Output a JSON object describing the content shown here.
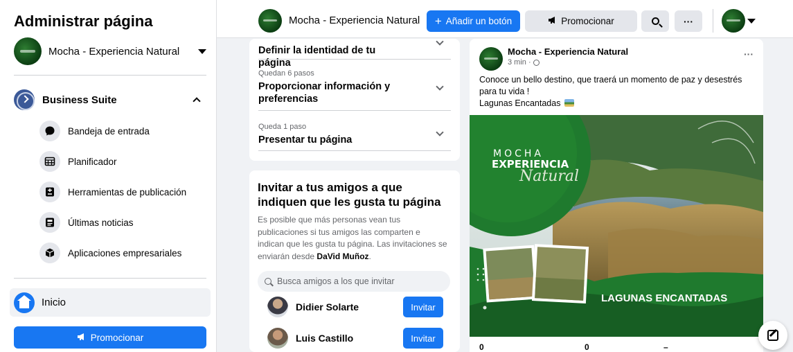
{
  "sidebar": {
    "title": "Administrar página",
    "page_name": "Mocha - Experiencia Natural",
    "business_suite": "Business Suite",
    "items": [
      {
        "label": "Bandeja de entrada",
        "icon": "chat-bubble-icon"
      },
      {
        "label": "Planificador",
        "icon": "calendar-icon"
      },
      {
        "label": "Herramientas de publicación",
        "icon": "publishing-tools-icon"
      },
      {
        "label": "Últimas noticias",
        "icon": "news-icon"
      },
      {
        "label": "Aplicaciones empresariales",
        "icon": "box-icon"
      }
    ],
    "home_label": "Inicio",
    "promote_label": "Promocionar"
  },
  "topbar": {
    "page_name": "Mocha - Experiencia Natural",
    "add_button_label": "Añadir un botón",
    "promote_label": "Promocionar",
    "more_label": "···"
  },
  "steps": [
    {
      "remaining": "",
      "title": "Definir la identidad de tu página"
    },
    {
      "remaining": "Quedan 6 pasos",
      "title": "Proporcionar información y preferencias"
    },
    {
      "remaining": "Queda 1 paso",
      "title": "Presentar tu página"
    }
  ],
  "invite": {
    "title": "Invitar a tus amigos a que indiquen que les gusta tu página",
    "desc_prefix": "Es posible que más personas vean tus publicaciones si tus amigos las comparten e indican que les gusta tu página. Las invitaciones se enviarán desde ",
    "desc_name": "DaVid Muñoz",
    "desc_suffix": ".",
    "search_placeholder": "Busca amigos a los que invitar",
    "invite_label": "Invitar",
    "friends": [
      {
        "name": "Didier Solarte"
      },
      {
        "name": "Luis Castillo"
      }
    ]
  },
  "post": {
    "author": "Mocha - Experiencia Natural",
    "time": "3 min ·",
    "more": "···",
    "text_line1": "Conoce un bello destino, que traerá un momento de paz y desestrés para tu vida !",
    "text_line2": "Lagunas Encantadas",
    "image": {
      "brand_top": "MOCHA",
      "brand_mid": "EXPERIENCIA",
      "brand_script": "Natural",
      "caption": "LAGUNAS ENCANTADAS"
    },
    "count_a": "0",
    "count_b": "0",
    "count_c": "–"
  },
  "colors": {
    "accent": "#1877f2",
    "background": "#f0f2f5",
    "brand_green": "#1f7a2e"
  }
}
